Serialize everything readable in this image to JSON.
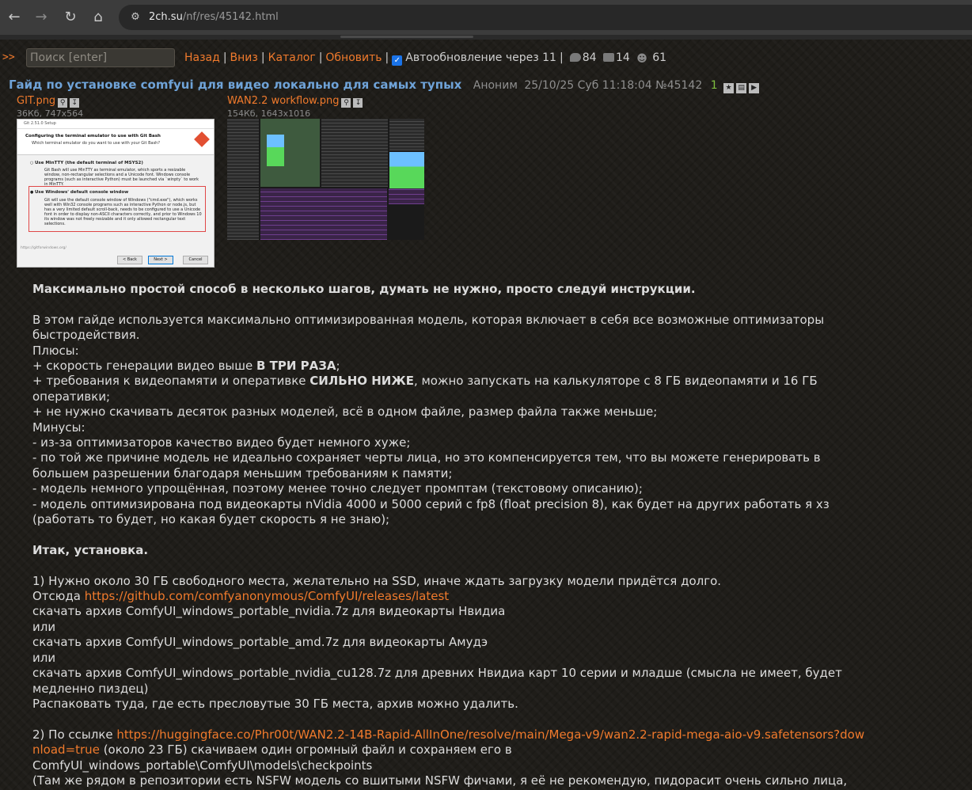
{
  "browser": {
    "url_host": "2ch.su",
    "url_path": "/nf/res/45142.html",
    "back_icon": "arrow-left-icon",
    "forward_icon": "arrow-right-icon",
    "reload_icon": "reload-icon",
    "home_icon": "home-icon"
  },
  "toolbar": {
    "arrows": ">>",
    "search_placeholder": "Поиск [enter]",
    "back": "Назад",
    "down": "Вниз",
    "catalog": "Каталог",
    "refresh": "Обновить",
    "autoupdate_label": "Автообновление через 11",
    "autoupdate_checked": true,
    "posts_count": "84",
    "images_count": "14",
    "posters_count": "61"
  },
  "post": {
    "title": "Гайд по установке comfyui для видео локально для самых тупых",
    "author": "Аноним",
    "date": "25/10/25 Суб 11:18:04",
    "number": "№45142",
    "replies": "1",
    "files": [
      {
        "name": "GIT.png",
        "info": "36Кб, 747x564"
      },
      {
        "name": "WAN2.2 workflow.png",
        "info": "154Кб, 1643x1016"
      }
    ],
    "thumb1": {
      "window_title": "Git 2.51.0 Setup",
      "heading": "Configuring the terminal emulator to use with Git Bash",
      "subheading": "Which terminal emulator do you want to use with your Git Bash?",
      "option1_title": "Use MinTTY (the default terminal of MSYS2)",
      "option1_text": "Git Bash will use MinTTY as terminal emulator, which sports a resizable window, non-rectangular selections and a Unicode font. Windows console programs (such as interactive Python) must be launched via `winpty` to work in MinTTY.",
      "option2_title": "Use Windows' default console window",
      "option2_text": "Git will use the default console window of Windows (\"cmd.exe\"), which works well with Win32 console programs such as interactive Python or node.js, but has a very limited default scroll-back, needs to be configured to use a Unicode font in order to display non-ASCII characters correctly, and prior to Windows 10 its window was not freely resizable and it only allowed rectangular text selections.",
      "link": "https://gitforwindows.org/",
      "back_btn": "< Back",
      "next_btn": "Next >",
      "cancel_btn": "Cancel"
    }
  },
  "body": {
    "l1": "Максимально простой способ в несколько шагов, думать не нужно, просто следуй инструкции.",
    "l2": "В этом гайде используется максимально оптимизированная модель, которая включает в себя все возможные оптимизаторы быстродействия.",
    "l3": "Плюсы:",
    "l4a": "+ скорость генерации видео выше ",
    "l4b": "В ТРИ РАЗА",
    "l4c": ";",
    "l5a": "+ требования к видеопамяти и оперативке ",
    "l5b": "СИЛЬНО НИЖЕ",
    "l5c": ", можно запускать на калькуляторе с 8 ГБ видеопамяти и 16 ГБ оперативки;",
    "l6": "+ не нужно скачивать десяток разных моделей, всё в одном файле, размер файла также меньше;",
    "l7": "Минусы:",
    "l8": "- из-за оптимизаторов качество видео будет немного хуже;",
    "l9": "- по той же причине модель не идеально сохраняет черты лица, но это компенсируется тем, что вы можете генерировать в большем разрешении благодаря меньшим требованиям к памяти;",
    "l10": "- модель немного упрощённая, поэтому менее точно следует промптам (текстовому описанию);",
    "l11": "- модель оптимизирована под видеокарты nVidia 4000 и 5000 серий с fp8 (float precision 8), как будет на других работать я хз (работать то будет, но какая будет скорость я не знаю);",
    "l12": "Итак, установка.",
    "l13": "1) Нужно около 30 ГБ свободного места, желательно на SSD, иначе ждать загрузку модели придётся долго.",
    "l14a": "Отсюда ",
    "l14link": "https://github.com/comfyanonymous/ComfyUI/releases/latest",
    "l15": "скачать архив ComfyUI_windows_portable_nvidia.7z для видеокарты Нвидиа",
    "l16": "или",
    "l17": "скачать архив ComfyUI_windows_portable_amd.7z для видеокарты Амудэ",
    "l18": "или",
    "l19": "скачать архив ComfyUI_windows_portable_nvidia_cu128.7z для древних Нвидиа карт 10 серии и младше (смысла не имеет, будет медленно пиздец)",
    "l20": "Распаковать туда, где есть пресловутые 30 ГБ места, архив можно удалить.",
    "l21a": "2) По ссылке ",
    "l21link": "https://huggingface.co/Phr00t/WAN2.2-14B-Rapid-AllInOne/resolve/main/Mega-v9/wan2.2-rapid-mega-aio-v9.safetensors?download=true",
    "l21b": " (около 23 ГБ) скачиваем один огромный файл и сохраняем его в",
    "l22": "ComfyUI_windows_portable\\ComfyUI\\models\\checkpoints",
    "l23": "(Там же рядом в репозитории есть NSFW модель со вшитыми NSFW фичами, я её не рекомендую, пидорасит очень сильно лица,"
  }
}
